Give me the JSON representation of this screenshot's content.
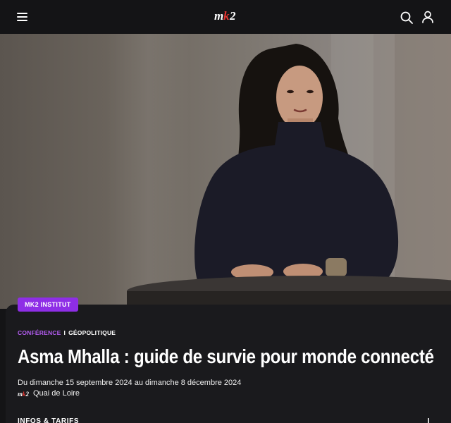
{
  "header": {
    "logo_text": "mk2",
    "menu_icon": "hamburger-menu-icon",
    "search_icon": "search-icon",
    "account_icon": "user-icon"
  },
  "hero": {
    "image": "portrait-photo"
  },
  "event": {
    "badge": "MK2 INSTITUT",
    "category_primary": "CONFÉRENCE",
    "category_separator": "I",
    "category_secondary": "GÉOPOLITIQUE",
    "title": "Asma Mhalla : guide de survie pour monde connecté",
    "dates": "Du dimanche 15 septembre 2024 au dimanche 8 décembre 2024",
    "venue_logo": "mk2",
    "venue": "Quai de Loire",
    "info_label": "INFOS & TARIFS"
  },
  "colors": {
    "accent": "#8e2ee6",
    "category_accent": "#b35cf0",
    "logo_accent": "#e3342f",
    "background": "#141416"
  }
}
